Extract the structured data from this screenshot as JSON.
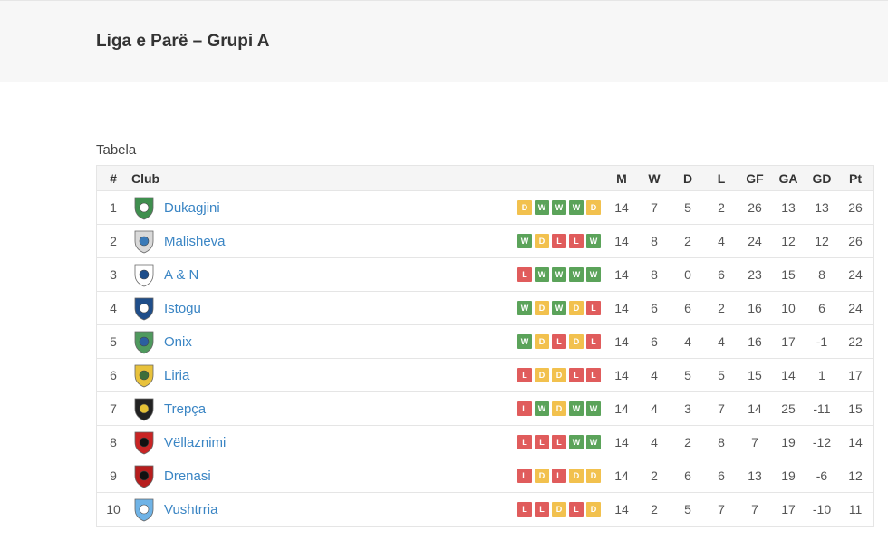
{
  "page": {
    "title": "Liga e Parë – Grupi A",
    "caption": "Tabela"
  },
  "columns": {
    "pos": "#",
    "club": "Club",
    "m": "M",
    "w": "W",
    "d": "D",
    "l": "L",
    "gf": "GF",
    "ga": "GA",
    "gd": "GD",
    "pt": "Pt"
  },
  "colors": {
    "win": "#5ba35a",
    "draw": "#f2c14e",
    "loss": "#e05c5c",
    "link": "#3a85c4"
  },
  "rows": [
    {
      "pos": "1",
      "club": "Dukagjini",
      "logo": "crest-green-icon",
      "form": [
        "D",
        "W",
        "W",
        "W",
        "D"
      ],
      "m": "14",
      "w": "7",
      "d": "5",
      "l": "2",
      "gf": "26",
      "ga": "13",
      "gd": "13",
      "pt": "26"
    },
    {
      "pos": "2",
      "club": "Malisheva",
      "logo": "crest-shield-icon",
      "form": [
        "W",
        "D",
        "L",
        "L",
        "W"
      ],
      "m": "14",
      "w": "8",
      "d": "2",
      "l": "4",
      "gf": "24",
      "ga": "12",
      "gd": "12",
      "pt": "26"
    },
    {
      "pos": "3",
      "club": "A & N",
      "logo": "crest-blue-outline-icon",
      "form": [
        "L",
        "W",
        "W",
        "W",
        "W"
      ],
      "m": "14",
      "w": "8",
      "d": "0",
      "l": "6",
      "gf": "23",
      "ga": "15",
      "gd": "8",
      "pt": "24"
    },
    {
      "pos": "4",
      "club": "Istogu",
      "logo": "crest-ball-blue-icon",
      "form": [
        "W",
        "D",
        "W",
        "D",
        "L"
      ],
      "m": "14",
      "w": "6",
      "d": "6",
      "l": "2",
      "gf": "16",
      "ga": "10",
      "gd": "6",
      "pt": "24"
    },
    {
      "pos": "5",
      "club": "Onix",
      "logo": "crest-green-blue-icon",
      "form": [
        "W",
        "D",
        "L",
        "D",
        "L"
      ],
      "m": "14",
      "w": "6",
      "d": "4",
      "l": "4",
      "gf": "16",
      "ga": "17",
      "gd": "-1",
      "pt": "22"
    },
    {
      "pos": "6",
      "club": "Liria",
      "logo": "crest-yellow-icon",
      "form": [
        "L",
        "D",
        "D",
        "L",
        "L"
      ],
      "m": "14",
      "w": "4",
      "d": "5",
      "l": "5",
      "gf": "15",
      "ga": "14",
      "gd": "1",
      "pt": "17"
    },
    {
      "pos": "7",
      "club": "Trepça",
      "logo": "crest-black-yellow-icon",
      "form": [
        "L",
        "W",
        "D",
        "W",
        "W"
      ],
      "m": "14",
      "w": "4",
      "d": "3",
      "l": "7",
      "gf": "14",
      "ga": "25",
      "gd": "-11",
      "pt": "15"
    },
    {
      "pos": "8",
      "club": "Vëllaznimi",
      "logo": "crest-red-black-icon",
      "form": [
        "L",
        "L",
        "L",
        "W",
        "W"
      ],
      "m": "14",
      "w": "4",
      "d": "2",
      "l": "8",
      "gf": "7",
      "ga": "19",
      "gd": "-12",
      "pt": "14"
    },
    {
      "pos": "9",
      "club": "Drenasi",
      "logo": "crest-red-black-wide-icon",
      "form": [
        "L",
        "D",
        "L",
        "D",
        "D"
      ],
      "m": "14",
      "w": "2",
      "d": "6",
      "l": "6",
      "gf": "13",
      "ga": "19",
      "gd": "-6",
      "pt": "12"
    },
    {
      "pos": "10",
      "club": "Vushtrria",
      "logo": "crest-light-blue-icon",
      "form": [
        "L",
        "L",
        "D",
        "L",
        "D"
      ],
      "m": "14",
      "w": "2",
      "d": "5",
      "l": "7",
      "gf": "7",
      "ga": "17",
      "gd": "-10",
      "pt": "11"
    }
  ]
}
